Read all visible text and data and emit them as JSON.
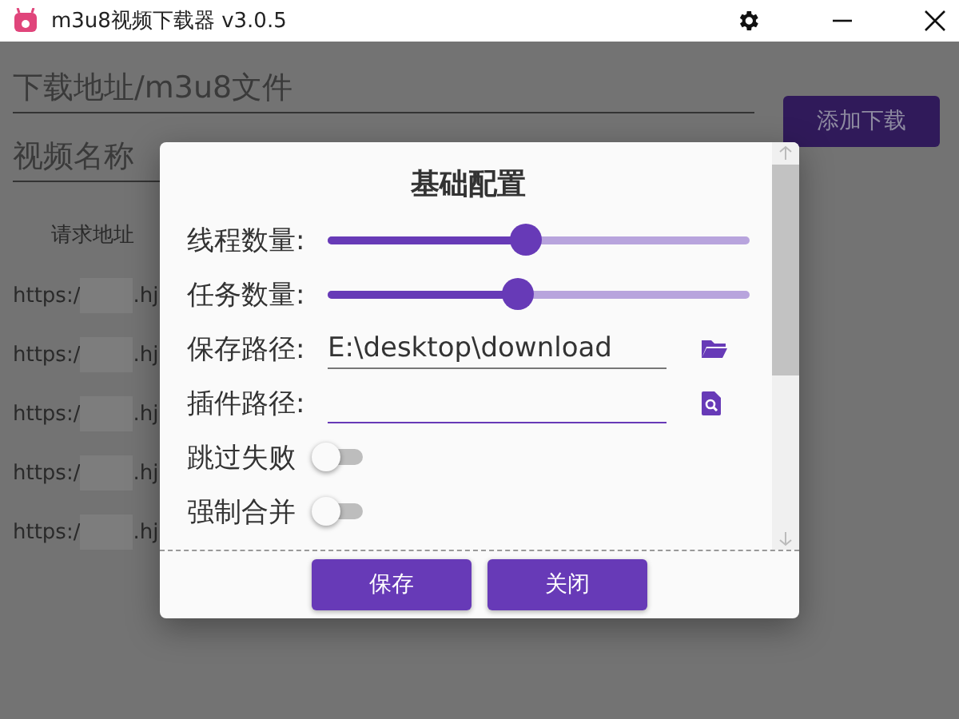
{
  "window": {
    "title": "m3u8视频下载器 v3.0.5"
  },
  "form": {
    "url_field": {
      "placeholder": "下载地址/m3u8文件"
    },
    "name_field": {
      "placeholder": "视频名称"
    },
    "add_button": "添加下载"
  },
  "table": {
    "columns": [
      "请求地址"
    ],
    "rows": [
      {
        "prefix": "https:/",
        "suffix": ".hj"
      },
      {
        "prefix": "https:/",
        "suffix": ".hj"
      },
      {
        "prefix": "https:/",
        "suffix": ".hj"
      },
      {
        "prefix": "https:/",
        "suffix": ".hj"
      },
      {
        "prefix": "https:/",
        "suffix": ".hj"
      }
    ]
  },
  "dialog": {
    "title": "基础配置",
    "settings": [
      {
        "kind": "slider",
        "label": "线程数量:",
        "level": 0.47
      },
      {
        "kind": "slider",
        "label": "任务数量:",
        "level": 0.45
      },
      {
        "kind": "folder",
        "label": "保存路径:",
        "value": "E:\\desktop\\download",
        "focused": false
      },
      {
        "kind": "file",
        "label": "插件路径:",
        "focused": true
      },
      {
        "kind": "toggle",
        "label": "跳过失败",
        "on": false
      },
      {
        "kind": "toggle",
        "label": "强制合并",
        "on": false
      }
    ],
    "buttons": [
      "保存",
      "关闭"
    ]
  }
}
